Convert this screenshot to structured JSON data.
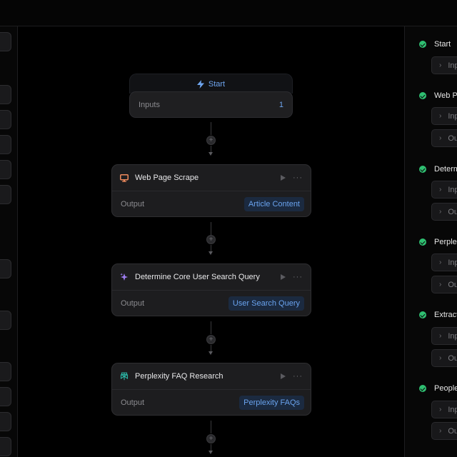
{
  "start": {
    "title": "Start",
    "inputs_label": "Inputs",
    "inputs_value": "1"
  },
  "nodes": [
    {
      "title": "Web Page Scrape",
      "icon": "monitor-icon",
      "output_label": "Output",
      "output_value": "Article Content"
    },
    {
      "title": "Determine Core User Search Query",
      "icon": "sparkle-icon",
      "output_label": "Output",
      "output_value": "User Search Query"
    },
    {
      "title": "Perplexity FAQ Research",
      "icon": "perplexity-icon",
      "output_label": "Output",
      "output_value": "Perplexity FAQs"
    }
  ],
  "run_steps": [
    {
      "label": "Start",
      "rows": [
        "Inp"
      ]
    },
    {
      "label": "Web Pa",
      "rows": [
        "Inp",
        "Out"
      ]
    },
    {
      "label": "Determ",
      "rows": [
        "Inp",
        "Out"
      ]
    },
    {
      "label": "Perplex",
      "rows": [
        "Inp",
        "Out"
      ]
    },
    {
      "label": "Extract",
      "rows": [
        "Inp",
        "Out"
      ]
    },
    {
      "label": "People",
      "rows": [
        "Inp",
        "Out"
      ]
    }
  ],
  "colors": {
    "accent": "#6fa6f0",
    "success": "#2fbf71",
    "background": "#000000"
  }
}
